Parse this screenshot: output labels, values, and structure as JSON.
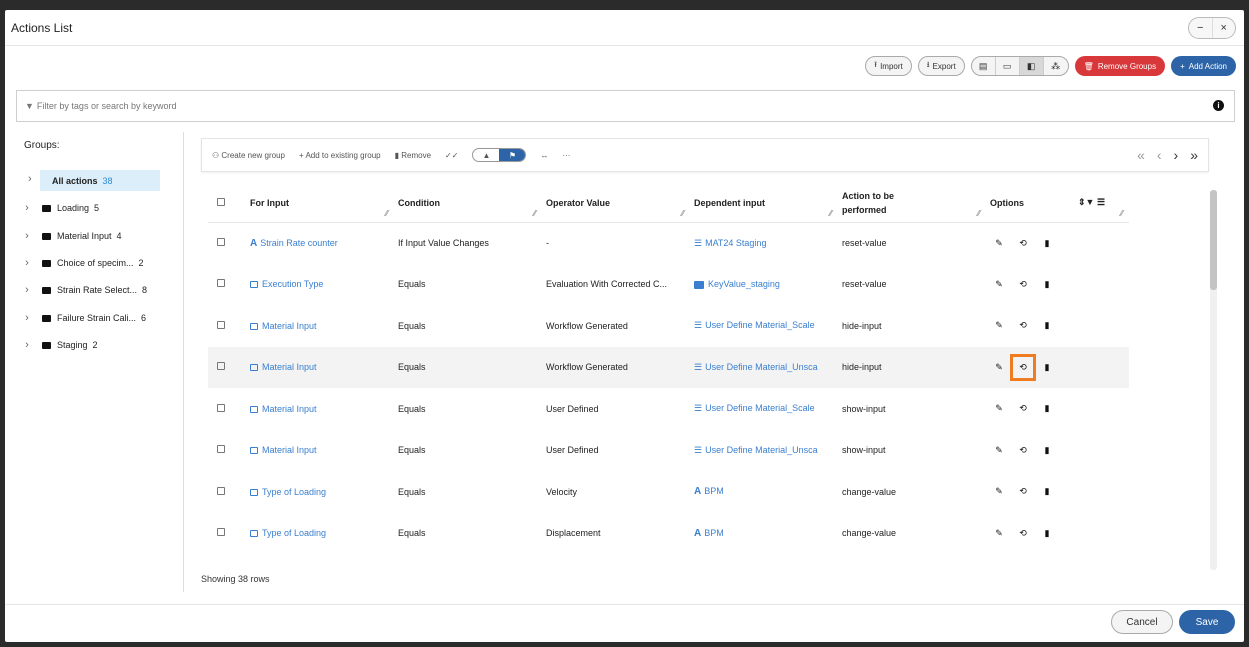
{
  "window": {
    "title": "Actions List",
    "min_label": "−",
    "close_label": "×"
  },
  "toolbar": {
    "import_label": "Import",
    "export_label": "Export",
    "remove_groups_label": "Remove Groups",
    "add_action_label": "Add Action",
    "view_icons": [
      "list-view-icon",
      "card-view-icon",
      "split-view-icon",
      "tree-view-icon"
    ],
    "active_view_index": 2
  },
  "filter": {
    "placeholder": "Filter by tags or search by keyword"
  },
  "groups": {
    "title": "Groups:",
    "all": {
      "label": "All actions",
      "count": "38"
    },
    "items": [
      {
        "label": "Loading",
        "count": "5"
      },
      {
        "label": "Material Input",
        "count": "4"
      },
      {
        "label": "Choice of specim...",
        "count": "2"
      },
      {
        "label": "Strain Rate Select...",
        "count": "8"
      },
      {
        "label": "Failure Strain Cali...",
        "count": "6"
      },
      {
        "label": "Staging",
        "count": "2"
      }
    ]
  },
  "main_toolbar": {
    "create_group": "Create new group",
    "add_existing": "Add to existing group",
    "remove": "Remove"
  },
  "table": {
    "headers": {
      "for_input": "For Input",
      "condition": "Condition",
      "operator_value": "Operator Value",
      "dependent_input": "Dependent input",
      "action": "Action to be performed",
      "options": "Options"
    },
    "rows": [
      {
        "for_input": "Strain Rate counter",
        "fi_icon": "A",
        "condition": "If Input Value Changes",
        "operator_value": "-",
        "dependent_input": "MAT24 Staging",
        "di_icon": "list",
        "action": "reset-value"
      },
      {
        "for_input": "Execution Type",
        "fi_icon": "select",
        "condition": "Equals",
        "operator_value": "Evaluation With Corrected C...",
        "dependent_input": "KeyValue_staging",
        "di_icon": "kv",
        "action": "reset-value"
      },
      {
        "for_input": "Material Input",
        "fi_icon": "select",
        "condition": "Equals",
        "operator_value": "Workflow Generated",
        "dependent_input": "User Define Material_Scale",
        "di_icon": "list",
        "action": "hide-input"
      },
      {
        "for_input": "Material Input",
        "fi_icon": "select",
        "condition": "Equals",
        "operator_value": "Workflow Generated",
        "dependent_input": "User Define Material_Unsca",
        "di_icon": "list",
        "action": "hide-input"
      },
      {
        "for_input": "Material Input",
        "fi_icon": "select",
        "condition": "Equals",
        "operator_value": "User Defined",
        "dependent_input": "User Define Material_Scale",
        "di_icon": "list",
        "action": "show-input"
      },
      {
        "for_input": "Material Input",
        "fi_icon": "select",
        "condition": "Equals",
        "operator_value": "User Defined",
        "dependent_input": "User Define Material_Unsca",
        "di_icon": "list",
        "action": "show-input"
      },
      {
        "for_input": "Type of Loading",
        "fi_icon": "select",
        "condition": "Equals",
        "operator_value": "Velocity",
        "dependent_input": "BPM",
        "di_icon": "A",
        "action": "change-value"
      },
      {
        "for_input": "Type of Loading",
        "fi_icon": "select",
        "condition": "Equals",
        "operator_value": "Displacement",
        "dependent_input": "BPM",
        "di_icon": "A",
        "action": "change-value"
      }
    ],
    "highlight_row_index": 3,
    "showing": "Showing 38 rows"
  },
  "footer": {
    "cancel_label": "Cancel",
    "save_label": "Save"
  }
}
